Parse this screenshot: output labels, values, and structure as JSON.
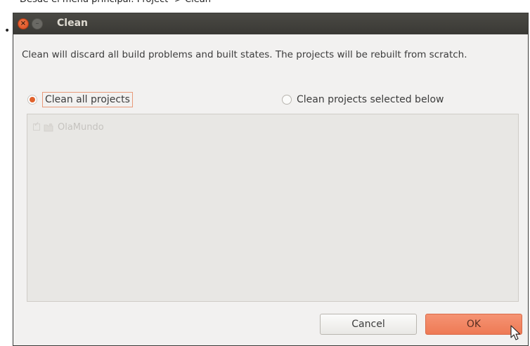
{
  "page": {
    "bullet": "•",
    "top_caption": "Desde el menú principal: Project -> Clean"
  },
  "dialog": {
    "title": "Clean",
    "description": "Clean will discard all build problems and built states.  The projects will be rebuilt from scratch.",
    "options": {
      "clean_all": "Clean all projects",
      "clean_selected": "Clean projects selected below",
      "selected": "clean_all"
    },
    "projects": [
      {
        "name": "OlaMundo",
        "checked": true,
        "disabled": true
      }
    ],
    "buttons": {
      "cancel": "Cancel",
      "ok": "OK"
    }
  },
  "colors": {
    "accent": "#e0622c",
    "ok_button": "#ee7a55",
    "titlebar": "#3c3b37",
    "dialog_bg": "#f2f1f0"
  },
  "icons": {
    "close": "close-icon",
    "minimize": "minimize-icon",
    "project": "project-folder-icon",
    "cursor": "mouse-pointer-icon"
  }
}
